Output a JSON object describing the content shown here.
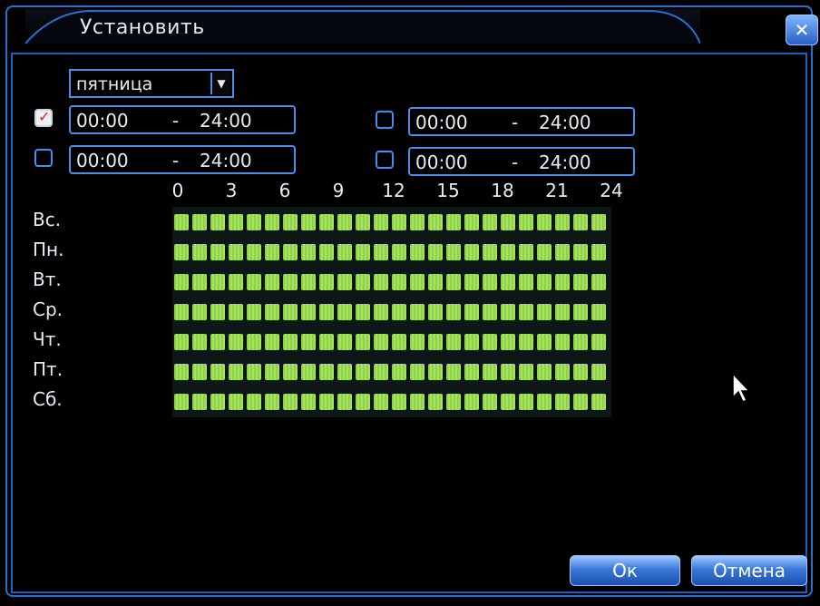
{
  "dialog": {
    "title": "Установить"
  },
  "day_select": {
    "value": "пятница"
  },
  "time_periods": [
    {
      "checked": true,
      "start": "00:00",
      "end": "24:00"
    },
    {
      "checked": false,
      "start": "00:00",
      "end": "24:00"
    },
    {
      "checked": false,
      "start": "00:00",
      "end": "24:00"
    },
    {
      "checked": false,
      "start": "00:00",
      "end": "24:00"
    }
  ],
  "time_separator": "-",
  "hour_labels": [
    "0",
    "3",
    "6",
    "9",
    "12",
    "15",
    "18",
    "21",
    "24"
  ],
  "day_labels": [
    "Вс.",
    "Пн.",
    "Вт.",
    "Ср.",
    "Чт.",
    "Пт.",
    "Сб."
  ],
  "schedule": {
    "hours_per_day": 24,
    "all_hours_selected": true,
    "selected_color": "#9ad955"
  },
  "buttons": {
    "ok": "Ок",
    "cancel": "Отмена"
  },
  "colors": {
    "accent": "#4a8cf0",
    "background": "#000000",
    "button": "#3a78d8"
  }
}
